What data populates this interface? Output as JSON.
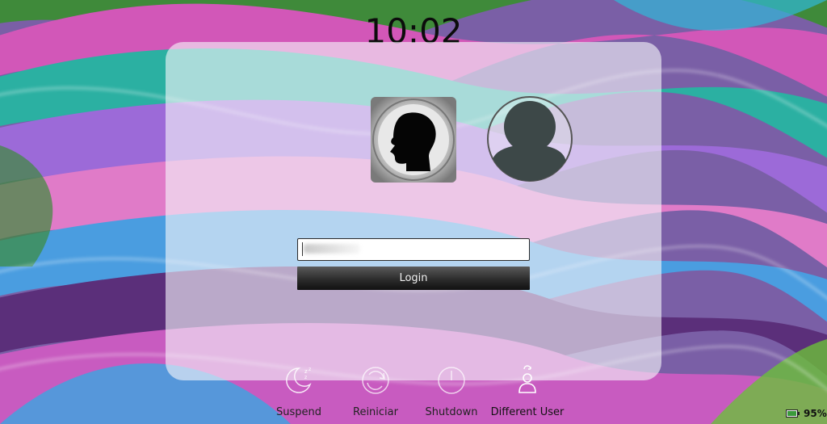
{
  "clock": {
    "time": "10:02"
  },
  "login": {
    "password_value": "",
    "button_label": "Login"
  },
  "actions": [
    {
      "label": "Suspend",
      "icon": "suspend-icon"
    },
    {
      "label": "Reiniciar",
      "icon": "restart-icon"
    },
    {
      "label": "Shutdown",
      "icon": "shutdown-icon"
    },
    {
      "label": "Different User",
      "icon": "different-user-icon"
    }
  ],
  "status": {
    "battery": "95%"
  },
  "colors": {
    "panel": "#f5f5fa",
    "button_dark": "#2c2c2c",
    "avatar_generic": "#3f4a4a"
  }
}
